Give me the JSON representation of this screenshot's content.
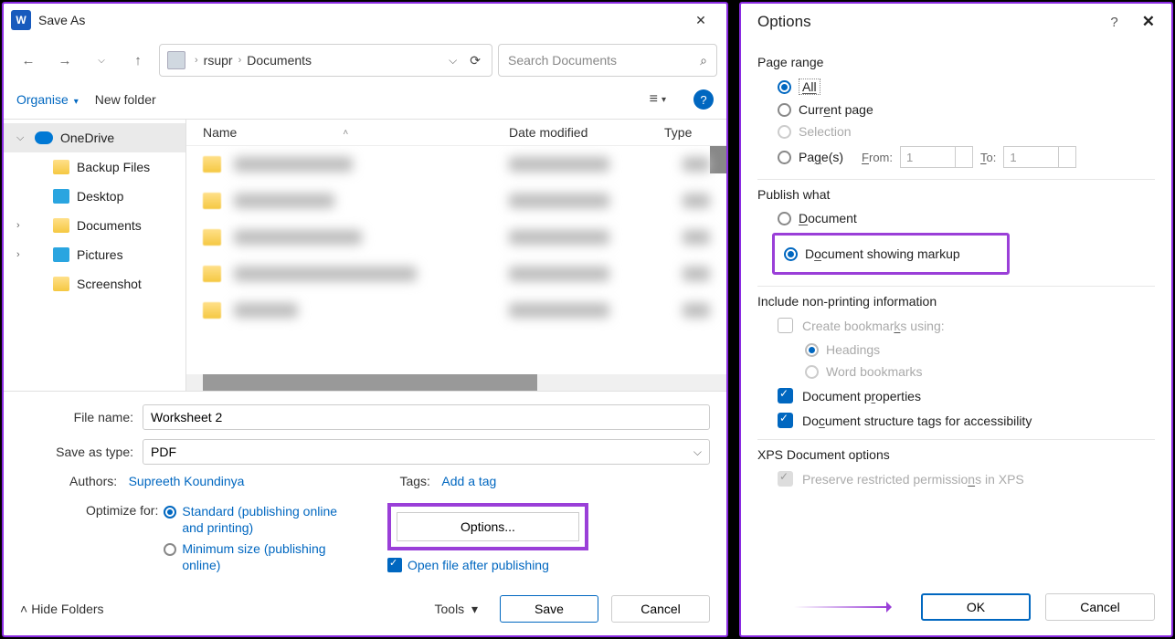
{
  "saveas": {
    "title": "Save As",
    "crumb1": "rsupr",
    "crumb2": "Documents",
    "search_placeholder": "Search Documents",
    "organise": "Organise",
    "newfolder": "New folder",
    "sidebar": {
      "onedrive": "OneDrive",
      "backup": "Backup Files",
      "desktop": "Desktop",
      "documents": "Documents",
      "pictures": "Pictures",
      "screenshot": "Screenshot"
    },
    "cols": {
      "name": "Name",
      "date": "Date modified",
      "type": "Type"
    },
    "filename_label": "File name:",
    "filename_value": "Worksheet 2",
    "savetype_label": "Save as type:",
    "savetype_value": "PDF",
    "authors_label": "Authors:",
    "authors_value": "Supreeth Koundinya",
    "tags_label": "Tags:",
    "tags_value": "Add a tag",
    "optimize_label": "Optimize for:",
    "opt_standard": "Standard (publishing online and printing)",
    "opt_min": "Minimum size (publishing online)",
    "options_btn": "Options...",
    "open_after": "Open file after publishing",
    "hide_folders": "Hide Folders",
    "tools": "Tools",
    "save": "Save",
    "cancel": "Cancel"
  },
  "options": {
    "title": "Options",
    "page_range": "Page range",
    "all": "All",
    "current": "Current page",
    "selection": "Selection",
    "pages": "Page(s)",
    "from": "From:",
    "to": "To:",
    "from_val": "1",
    "to_val": "1",
    "publish_what": "Publish what",
    "document": "Document",
    "doc_markup": "Document showing markup",
    "include_np": "Include non-printing information",
    "create_bm": "Create bookmarks using:",
    "headings": "Headings",
    "word_bm": "Word bookmarks",
    "doc_props": "Document properties",
    "doc_struct": "Document structure tags for accessibility",
    "xps_opts": "XPS Document options",
    "preserve_xps": "Preserve restricted permissions in XPS",
    "ok": "OK",
    "cancel": "Cancel"
  }
}
